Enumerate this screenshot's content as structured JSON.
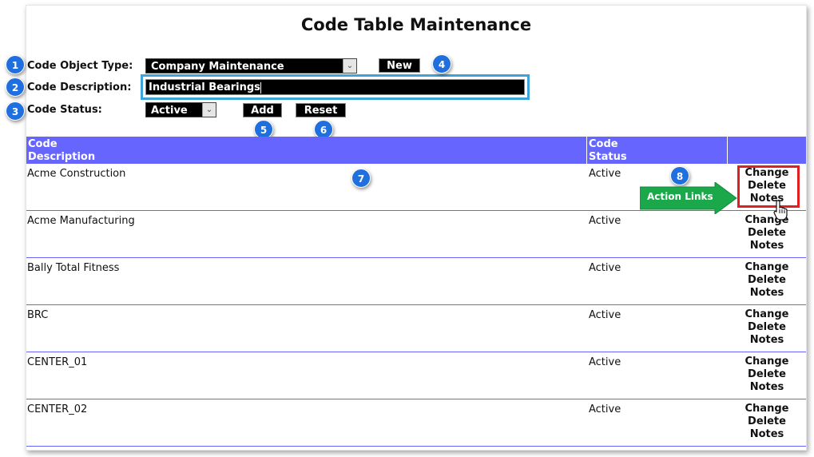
{
  "page": {
    "title": "Code Table Maintenance"
  },
  "form": {
    "object_type_label": "Code Object Type:",
    "object_type_value": "Company Maintenance",
    "new_label": "New",
    "description_label": "Code Description:",
    "description_value": "Industrial Bearings",
    "status_label": "Code Status:",
    "status_value": "Active",
    "add_label": "Add",
    "reset_label": "Reset"
  },
  "callouts": [
    "1",
    "2",
    "3",
    "4",
    "5",
    "6",
    "7",
    "8"
  ],
  "annotation": {
    "arrow_label": "Action Links",
    "arrow_color": "#1aa84a",
    "highlight_color": "#e02020"
  },
  "table": {
    "headers": {
      "desc_line1": "Code",
      "desc_line2": "Description",
      "status_line1": "Code",
      "status_line2": "Status"
    },
    "header_color": "#6666ff",
    "rows": [
      {
        "description": "Acme Construction",
        "status": "Active",
        "change": "Change",
        "delete": "Delete",
        "notes": "Notes"
      },
      {
        "description": "Acme Manufacturing",
        "status": "Active",
        "change": "Change",
        "delete": "Delete",
        "notes": "Notes"
      },
      {
        "description": "Bally Total Fitness",
        "status": "Active",
        "change": "Change",
        "delete": "Delete",
        "notes": "Notes"
      },
      {
        "description": "BRC",
        "status": "Active",
        "change": "Change",
        "delete": "Delete",
        "notes": "Notes"
      },
      {
        "description": "CENTER_01",
        "status": "Active",
        "change": "Change",
        "delete": "Delete",
        "notes": "Notes"
      },
      {
        "description": "CENTER_02",
        "status": "Active",
        "change": "Change",
        "delete": "Delete",
        "notes": "Notes"
      }
    ]
  }
}
